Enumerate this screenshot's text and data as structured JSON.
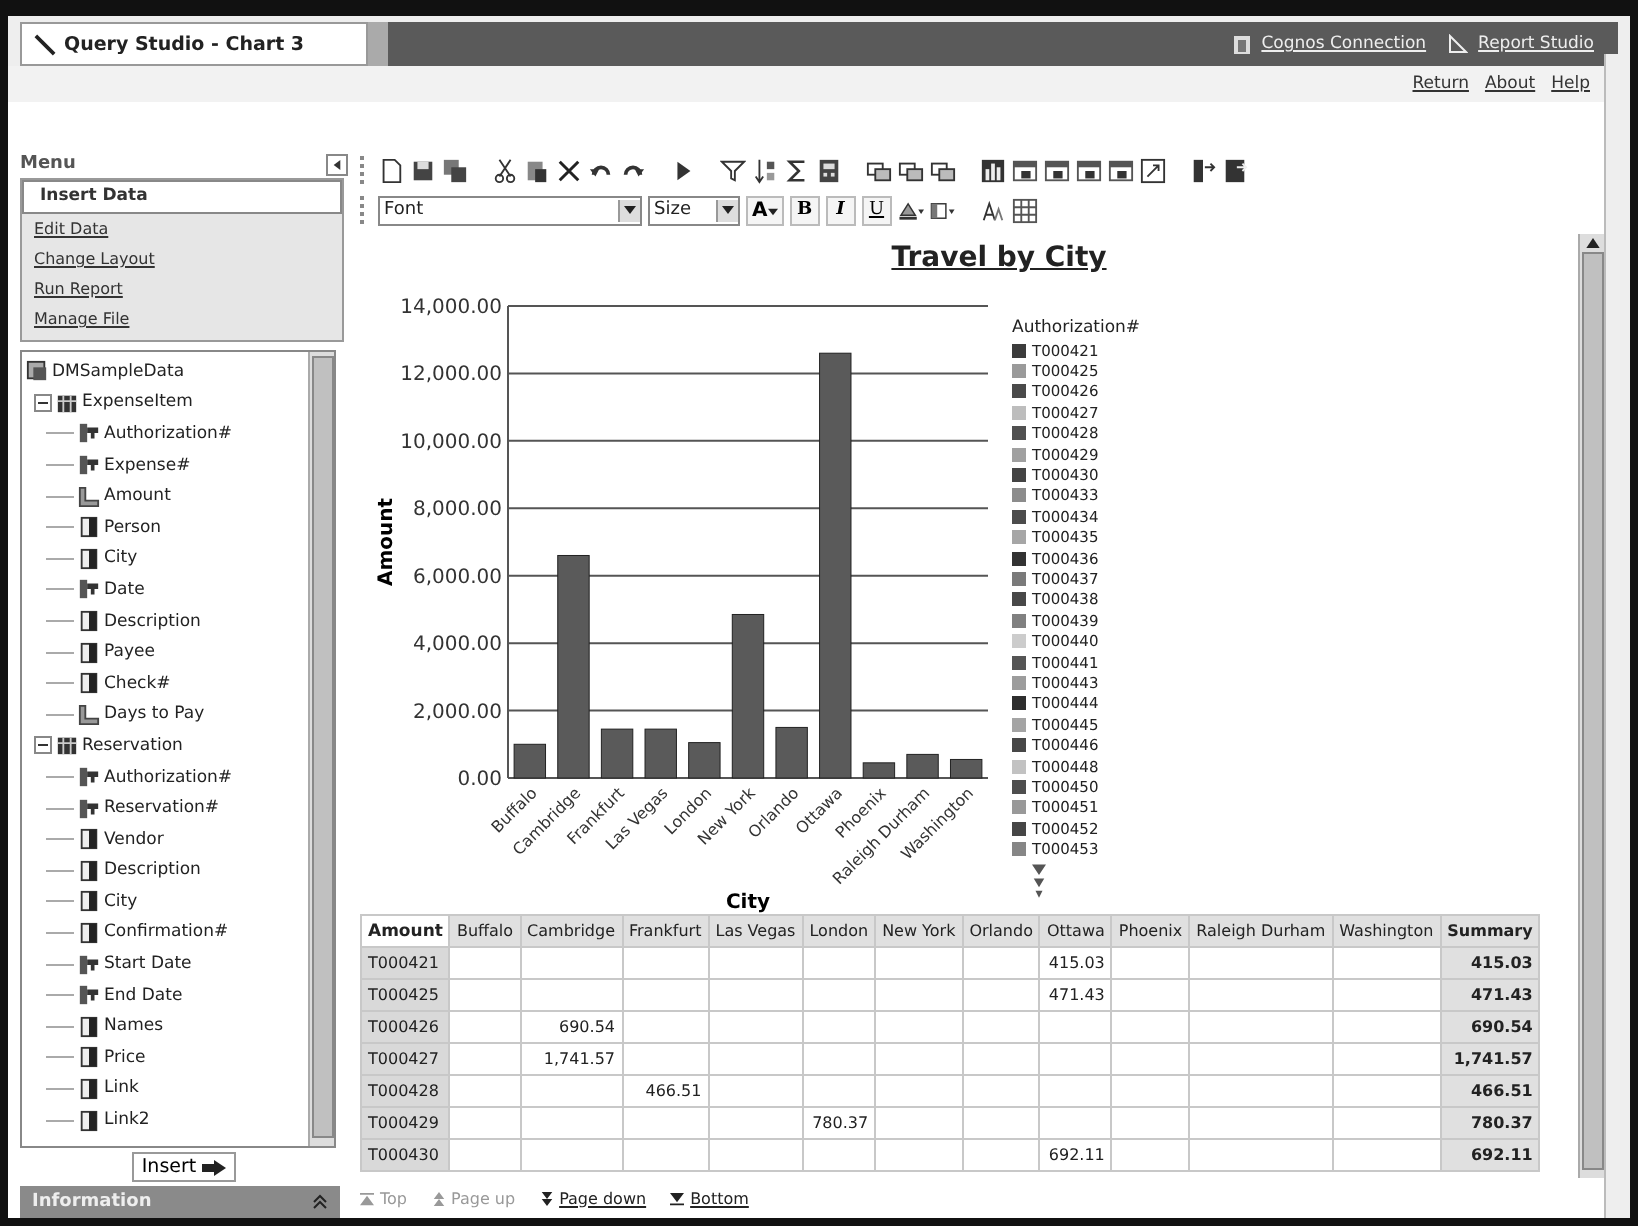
{
  "window": {
    "title": "Query Studio - Chart 3"
  },
  "header_links": [
    {
      "label": "Cognos Connection",
      "kind": "portal"
    },
    {
      "label": "Report Studio",
      "kind": "studio"
    }
  ],
  "top_links": [
    "Return",
    "About",
    "Help"
  ],
  "menu": {
    "title": "Menu",
    "items": [
      {
        "label": "Insert Data",
        "selected": true
      },
      {
        "label": "Edit Data",
        "selected": false
      },
      {
        "label": "Change Layout",
        "selected": false
      },
      {
        "label": "Run Report",
        "selected": false
      },
      {
        "label": "Manage File",
        "selected": false
      }
    ]
  },
  "tree": {
    "root": "DMSampleData",
    "children": [
      {
        "label": "ExpenseItem",
        "expanded": true,
        "children": [
          {
            "label": "Authorization#",
            "kind": "key"
          },
          {
            "label": "Expense#",
            "kind": "key"
          },
          {
            "label": "Amount",
            "kind": "measure"
          },
          {
            "label": "Person",
            "kind": "attribute"
          },
          {
            "label": "City",
            "kind": "attribute"
          },
          {
            "label": "Date",
            "kind": "key"
          },
          {
            "label": "Description",
            "kind": "attribute"
          },
          {
            "label": "Payee",
            "kind": "attribute"
          },
          {
            "label": "Check#",
            "kind": "attribute"
          },
          {
            "label": "Days to Pay",
            "kind": "measure"
          }
        ]
      },
      {
        "label": "Reservation",
        "expanded": true,
        "children": [
          {
            "label": "Authorization#",
            "kind": "key"
          },
          {
            "label": "Reservation#",
            "kind": "key"
          },
          {
            "label": "Vendor",
            "kind": "attribute"
          },
          {
            "label": "Description",
            "kind": "attribute"
          },
          {
            "label": "City",
            "kind": "attribute"
          },
          {
            "label": "Confirmation#",
            "kind": "attribute"
          },
          {
            "label": "Start Date",
            "kind": "key"
          },
          {
            "label": "End Date",
            "kind": "key"
          },
          {
            "label": "Names",
            "kind": "attribute"
          },
          {
            "label": "Price",
            "kind": "attribute"
          },
          {
            "label": "Link",
            "kind": "attribute"
          },
          {
            "label": "Link2",
            "kind": "attribute"
          }
        ]
      }
    ]
  },
  "insert_button": "Insert",
  "information": "Information",
  "format_toolbar": {
    "font": "Font",
    "size": "Size",
    "buttons": [
      {
        "label": "A",
        "kind": "color"
      },
      {
        "label": "B",
        "kind": "bold"
      },
      {
        "label": "I",
        "kind": "italic"
      },
      {
        "label": "U",
        "kind": "underline"
      }
    ]
  },
  "report": {
    "title": "Travel by City",
    "chart": {
      "chart_data": {
        "type": "bar",
        "xlabel": "City",
        "ylabel": "Amount",
        "grid": true,
        "categories": [
          "Buffalo",
          "Cambridge",
          "Frankfurt",
          "Las Vegas",
          "London",
          "New York",
          "Orlando",
          "Ottawa",
          "Phoenix",
          "Raleigh Durham",
          "Washington"
        ],
        "series": [
          {
            "color": "#5a5a5a",
            "values": [
              1000,
              6600,
              1450,
              1450,
              1050,
              4850,
              1500,
              12600,
              450,
              700,
              550
            ]
          }
        ],
        "ylim": [
          0,
          14000
        ],
        "yticks": [
          {
            "value": 0,
            "label": "0.00"
          },
          {
            "value": 2000,
            "label": "2,000.00"
          },
          {
            "value": 4000,
            "label": "4,000.00"
          },
          {
            "value": 6000,
            "label": "6,000.00"
          },
          {
            "value": 8000,
            "label": "8,000.00"
          },
          {
            "value": 10000,
            "label": "10,000.00"
          },
          {
            "value": 12000,
            "label": "12,000.00"
          },
          {
            "value": 14000,
            "label": "14,000.00"
          }
        ]
      },
      "legend": {
        "title": "Authorization#",
        "items": [
          {
            "label": "T000421",
            "color": "#3c3c3c"
          },
          {
            "label": "T000425",
            "color": "#9a9a9a"
          },
          {
            "label": "T000426",
            "color": "#4a4a4a"
          },
          {
            "label": "T000427",
            "color": "#bdbdbd"
          },
          {
            "label": "T000428",
            "color": "#505050"
          },
          {
            "label": "T000429",
            "color": "#a0a0a0"
          },
          {
            "label": "T000430",
            "color": "#444444"
          },
          {
            "label": "T000433",
            "color": "#8c8c8c"
          },
          {
            "label": "T000434",
            "color": "#4c4c4c"
          },
          {
            "label": "T000435",
            "color": "#a6a6a6"
          },
          {
            "label": "T000436",
            "color": "#333333"
          },
          {
            "label": "T000437",
            "color": "#7a7a7a"
          },
          {
            "label": "T000438",
            "color": "#484848"
          },
          {
            "label": "T000439",
            "color": "#808080"
          },
          {
            "label": "T000440",
            "color": "#cccccc"
          },
          {
            "label": "T000441",
            "color": "#555555"
          },
          {
            "label": "T000443",
            "color": "#9c9c9c"
          },
          {
            "label": "T000444",
            "color": "#2e2e2e"
          },
          {
            "label": "T000445",
            "color": "#a4a4a4"
          },
          {
            "label": "T000446",
            "color": "#474747"
          },
          {
            "label": "T000448",
            "color": "#c2c2c2"
          },
          {
            "label": "T000450",
            "color": "#4e4e4e"
          },
          {
            "label": "T000451",
            "color": "#999999"
          },
          {
            "label": "T000452",
            "color": "#464646"
          },
          {
            "label": "T000453",
            "color": "#868686"
          }
        ]
      }
    },
    "table": {
      "corner": "Amount",
      "columns": [
        "Buffalo",
        "Cambridge",
        "Frankfurt",
        "Las Vegas",
        "London",
        "New York",
        "Orlando",
        "Ottawa",
        "Phoenix",
        "Raleigh Durham",
        "Washington"
      ],
      "summary": "Summary",
      "rows": [
        {
          "label": "T000421",
          "cells": [
            null,
            null,
            null,
            null,
            null,
            null,
            null,
            "415.03",
            null,
            null,
            null
          ],
          "summary": "415.03"
        },
        {
          "label": "T000425",
          "cells": [
            null,
            null,
            null,
            null,
            null,
            null,
            null,
            "471.43",
            null,
            null,
            null
          ],
          "summary": "471.43"
        },
        {
          "label": "T000426",
          "cells": [
            null,
            "690.54",
            null,
            null,
            null,
            null,
            null,
            null,
            null,
            null,
            null
          ],
          "summary": "690.54"
        },
        {
          "label": "T000427",
          "cells": [
            null,
            "1,741.57",
            null,
            null,
            null,
            null,
            null,
            null,
            null,
            null,
            null
          ],
          "summary": "1,741.57"
        },
        {
          "label": "T000428",
          "cells": [
            null,
            null,
            "466.51",
            null,
            null,
            null,
            null,
            null,
            null,
            null,
            null
          ],
          "summary": "466.51"
        },
        {
          "label": "T000429",
          "cells": [
            null,
            null,
            null,
            null,
            "780.37",
            null,
            null,
            null,
            null,
            null,
            null
          ],
          "summary": "780.37"
        },
        {
          "label": "T000430",
          "cells": [
            null,
            null,
            null,
            null,
            null,
            null,
            null,
            "692.11",
            null,
            null,
            null
          ],
          "summary": "692.11"
        }
      ]
    },
    "pager": [
      {
        "label": "Top",
        "disabled": true,
        "kind": "first"
      },
      {
        "label": "Page up",
        "disabled": true,
        "kind": "up"
      },
      {
        "label": "Page down",
        "disabled": false,
        "kind": "down"
      },
      {
        "label": "Bottom",
        "disabled": false,
        "kind": "last"
      }
    ]
  }
}
